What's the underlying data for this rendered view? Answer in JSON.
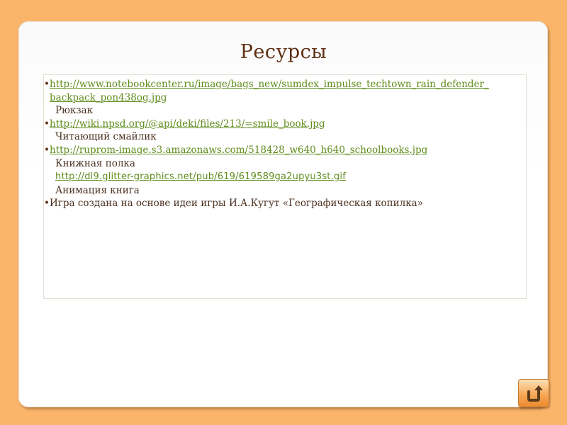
{
  "slide": {
    "title": "Ресурсы"
  },
  "resources": [
    {
      "link_line1": "http://www.notebookcenter.ru/image/bags_new/sumdex_impulse_techtown_rain_defender_",
      "link_line2": "backpack_pon438og.jpg",
      "caption": "Рюкзак"
    },
    {
      "link": "http://wiki.npsd.org/@api/deki/files/213/=smile_book.jpg",
      "caption": "Читающий смайлик"
    },
    {
      "link": "http://ruprom-image.s3.amazonaws.com/518428_w640_h640_schoolbooks.jpg",
      "caption": "Книжная полка",
      "link2": "http://dl9.glitter-graphics.net/pub/619/619589ga2upyu3st.gif",
      "caption2": "Анимация книга"
    },
    {
      "text": "Игра создана на основе идеи игры И.А.Кугут «Географическая копилка»"
    }
  ],
  "bullet_char": "•",
  "nav": {
    "return_icon": "return-arrow-icon"
  },
  "colors": {
    "background": "#fbb56a",
    "title": "#5e2f14",
    "link": "#5f8c1c",
    "text": "#4a3020"
  }
}
